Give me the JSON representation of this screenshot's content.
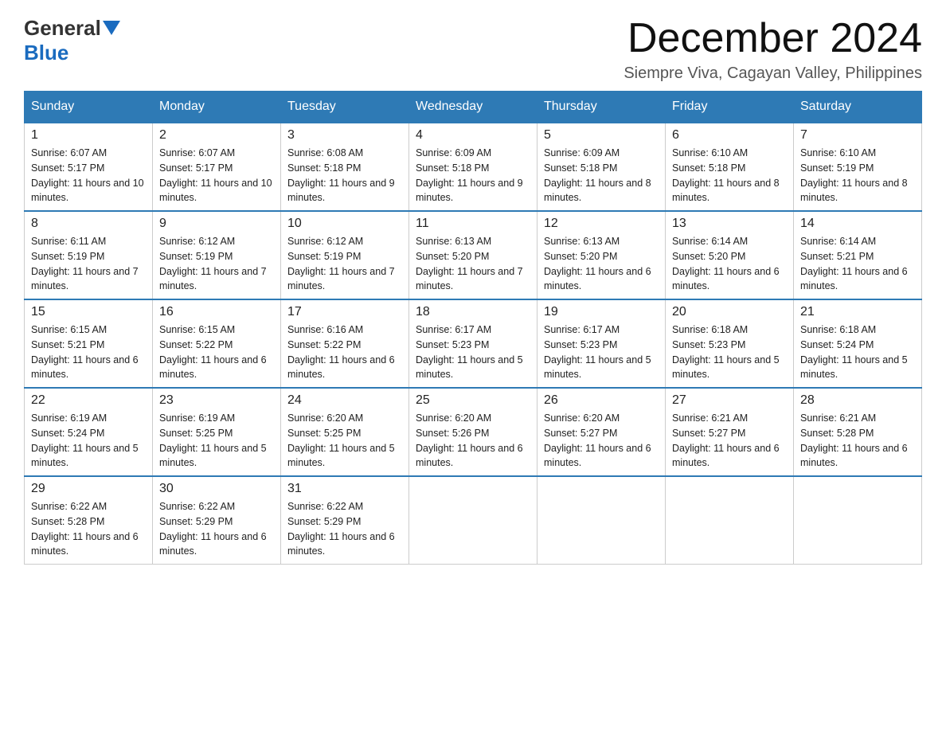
{
  "header": {
    "logo_general": "General",
    "logo_blue": "Blue",
    "month_title": "December 2024",
    "subtitle": "Siempre Viva, Cagayan Valley, Philippines"
  },
  "weekdays": [
    "Sunday",
    "Monday",
    "Tuesday",
    "Wednesday",
    "Thursday",
    "Friday",
    "Saturday"
  ],
  "weeks": [
    [
      {
        "day": "1",
        "sunrise": "6:07 AM",
        "sunset": "5:17 PM",
        "daylight": "11 hours and 10 minutes."
      },
      {
        "day": "2",
        "sunrise": "6:07 AM",
        "sunset": "5:17 PM",
        "daylight": "11 hours and 10 minutes."
      },
      {
        "day": "3",
        "sunrise": "6:08 AM",
        "sunset": "5:18 PM",
        "daylight": "11 hours and 9 minutes."
      },
      {
        "day": "4",
        "sunrise": "6:09 AM",
        "sunset": "5:18 PM",
        "daylight": "11 hours and 9 minutes."
      },
      {
        "day": "5",
        "sunrise": "6:09 AM",
        "sunset": "5:18 PM",
        "daylight": "11 hours and 8 minutes."
      },
      {
        "day": "6",
        "sunrise": "6:10 AM",
        "sunset": "5:18 PM",
        "daylight": "11 hours and 8 minutes."
      },
      {
        "day": "7",
        "sunrise": "6:10 AM",
        "sunset": "5:19 PM",
        "daylight": "11 hours and 8 minutes."
      }
    ],
    [
      {
        "day": "8",
        "sunrise": "6:11 AM",
        "sunset": "5:19 PM",
        "daylight": "11 hours and 7 minutes."
      },
      {
        "day": "9",
        "sunrise": "6:12 AM",
        "sunset": "5:19 PM",
        "daylight": "11 hours and 7 minutes."
      },
      {
        "day": "10",
        "sunrise": "6:12 AM",
        "sunset": "5:19 PM",
        "daylight": "11 hours and 7 minutes."
      },
      {
        "day": "11",
        "sunrise": "6:13 AM",
        "sunset": "5:20 PM",
        "daylight": "11 hours and 7 minutes."
      },
      {
        "day": "12",
        "sunrise": "6:13 AM",
        "sunset": "5:20 PM",
        "daylight": "11 hours and 6 minutes."
      },
      {
        "day": "13",
        "sunrise": "6:14 AM",
        "sunset": "5:20 PM",
        "daylight": "11 hours and 6 minutes."
      },
      {
        "day": "14",
        "sunrise": "6:14 AM",
        "sunset": "5:21 PM",
        "daylight": "11 hours and 6 minutes."
      }
    ],
    [
      {
        "day": "15",
        "sunrise": "6:15 AM",
        "sunset": "5:21 PM",
        "daylight": "11 hours and 6 minutes."
      },
      {
        "day": "16",
        "sunrise": "6:15 AM",
        "sunset": "5:22 PM",
        "daylight": "11 hours and 6 minutes."
      },
      {
        "day": "17",
        "sunrise": "6:16 AM",
        "sunset": "5:22 PM",
        "daylight": "11 hours and 6 minutes."
      },
      {
        "day": "18",
        "sunrise": "6:17 AM",
        "sunset": "5:23 PM",
        "daylight": "11 hours and 5 minutes."
      },
      {
        "day": "19",
        "sunrise": "6:17 AM",
        "sunset": "5:23 PM",
        "daylight": "11 hours and 5 minutes."
      },
      {
        "day": "20",
        "sunrise": "6:18 AM",
        "sunset": "5:23 PM",
        "daylight": "11 hours and 5 minutes."
      },
      {
        "day": "21",
        "sunrise": "6:18 AM",
        "sunset": "5:24 PM",
        "daylight": "11 hours and 5 minutes."
      }
    ],
    [
      {
        "day": "22",
        "sunrise": "6:19 AM",
        "sunset": "5:24 PM",
        "daylight": "11 hours and 5 minutes."
      },
      {
        "day": "23",
        "sunrise": "6:19 AM",
        "sunset": "5:25 PM",
        "daylight": "11 hours and 5 minutes."
      },
      {
        "day": "24",
        "sunrise": "6:20 AM",
        "sunset": "5:25 PM",
        "daylight": "11 hours and 5 minutes."
      },
      {
        "day": "25",
        "sunrise": "6:20 AM",
        "sunset": "5:26 PM",
        "daylight": "11 hours and 6 minutes."
      },
      {
        "day": "26",
        "sunrise": "6:20 AM",
        "sunset": "5:27 PM",
        "daylight": "11 hours and 6 minutes."
      },
      {
        "day": "27",
        "sunrise": "6:21 AM",
        "sunset": "5:27 PM",
        "daylight": "11 hours and 6 minutes."
      },
      {
        "day": "28",
        "sunrise": "6:21 AM",
        "sunset": "5:28 PM",
        "daylight": "11 hours and 6 minutes."
      }
    ],
    [
      {
        "day": "29",
        "sunrise": "6:22 AM",
        "sunset": "5:28 PM",
        "daylight": "11 hours and 6 minutes."
      },
      {
        "day": "30",
        "sunrise": "6:22 AM",
        "sunset": "5:29 PM",
        "daylight": "11 hours and 6 minutes."
      },
      {
        "day": "31",
        "sunrise": "6:22 AM",
        "sunset": "5:29 PM",
        "daylight": "11 hours and 6 minutes."
      },
      null,
      null,
      null,
      null
    ]
  ],
  "labels": {
    "sunrise": "Sunrise: ",
    "sunset": "Sunset: ",
    "daylight": "Daylight: "
  }
}
